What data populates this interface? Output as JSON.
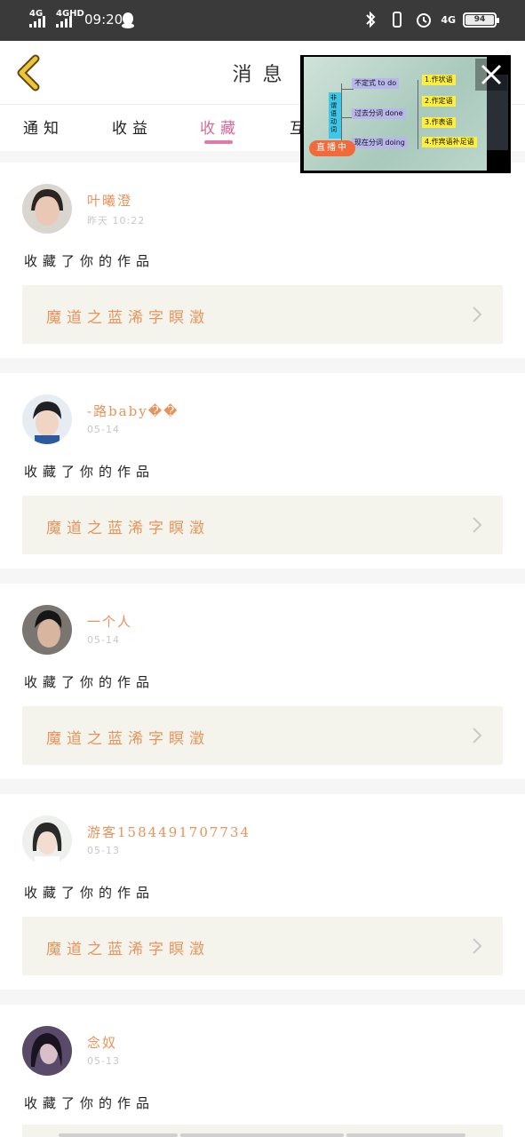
{
  "status_bar": {
    "net1": "4G",
    "net2": "4GHD",
    "time": "09:20",
    "net3": "4G",
    "battery": "94",
    "icons": [
      "qq-icon",
      "bluetooth-icon",
      "vibrate-icon",
      "alarm-icon",
      "signal-4g-icon",
      "battery-icon"
    ]
  },
  "header": {
    "title": "消息",
    "back_icon": "chevron-left-icon"
  },
  "tabs": [
    {
      "label": "通知",
      "active": false
    },
    {
      "label": "收益",
      "active": false
    },
    {
      "label": "收藏",
      "active": true
    },
    {
      "label": "互",
      "active": false
    }
  ],
  "live_overlay": {
    "badge": "直播中",
    "vertical_label": "非谓语动词",
    "boxes": [
      "不定式 to do",
      "过去分词 done",
      "现在分词 doing",
      "1.作状语",
      "2.作定语",
      "3.作表语",
      "4.作宾语补足语"
    ],
    "close_icon": "close-icon"
  },
  "items": [
    {
      "user": "叶曦澄",
      "time": "昨天 10:22",
      "action": "收藏了你的作品",
      "work": "魔道之蓝浠字瞑澂"
    },
    {
      "user": "-路baby��",
      "time": "05-14",
      "action": "收藏了你的作品",
      "work": "魔道之蓝浠字瞑澂"
    },
    {
      "user": "一个人",
      "time": "05-14",
      "action": "收藏了你的作品",
      "work": "魔道之蓝浠字瞑澂"
    },
    {
      "user": "游客1584491707734",
      "time": "05-13",
      "action": "收藏了你的作品",
      "work": "魔道之蓝浠字瞑澂"
    },
    {
      "user": "念奴",
      "time": "05-13",
      "action": "收藏了你的作品",
      "work": ""
    }
  ],
  "colors": {
    "accent_pink": "#e07aa8",
    "username_orange": "#e8935b",
    "card_bg": "#f4f4ec",
    "back_yellow": "#f0c43a"
  }
}
